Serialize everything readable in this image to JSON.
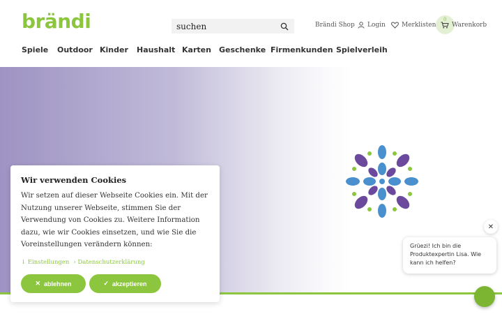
{
  "brand": {
    "logo_text": "brändi",
    "accent_color": "#8cc63f"
  },
  "search": {
    "value": "suchen",
    "icon": "search-icon"
  },
  "top_links": {
    "shop": "Brändi Shop",
    "login": "Login",
    "wishlist": "Merklisten",
    "cart": "Warenkorb",
    "cart_count": "0"
  },
  "nav": {
    "items": [
      "Spiele",
      "Outdoor",
      "Kinder",
      "Haushalt",
      "Karten",
      "Geschenke",
      "Firmenkunden",
      "Spielverleih"
    ]
  },
  "cookie": {
    "title": "Wir verwenden Cookies",
    "body": "Wir setzen auf dieser Webseite Cookies ein. Mit der Nutzung unserer Webseite, stimmen Sie der Verwendung von Cookies zu. Weitere Information dazu, wie wir Cookies einsetzen, und wie Sie die Voreinstellungen verändern können:",
    "settings_link": "Einstellungen",
    "privacy_link": "Datenschutzerklärung",
    "decline_label": "ablehnen",
    "accept_label": "akzeptieren"
  },
  "chat": {
    "message": "Grüezi! Ich bin die Produktexpertin Lisa. Wie kann ich helfen?",
    "close_symbol": "✕"
  }
}
